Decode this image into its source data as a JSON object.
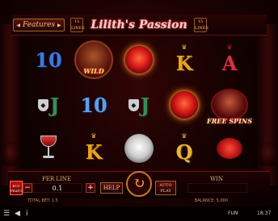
{
  "header": {
    "features_label": "Features",
    "title": "Lilith's Passion",
    "badge_left": "15 LINES",
    "badge_right": "15 LINES"
  },
  "reels": {
    "columns": [
      [
        "10",
        "J",
        "goblet"
      ],
      [
        "wild",
        "10",
        "K"
      ],
      [
        "heart",
        "J",
        "rose"
      ],
      [
        "K",
        "heart",
        "Q"
      ],
      [
        "A",
        "free-spins",
        "lips"
      ]
    ],
    "wild_label": "WILD",
    "free_spins_label": "FREE SPINS"
  },
  "controls": {
    "buy_label": "BUY FEATURE",
    "per_line_label": "PER LINE",
    "per_line_value": "0.1",
    "minus": "−",
    "plus": "+",
    "help_label": "HELP",
    "spin_icon": "↻",
    "autoplay_label": "AUTO PLAY",
    "win_label": "WIN",
    "win_value": ""
  },
  "info": {
    "total_bet": "TOTAL BET: 1.5",
    "balance": "BALANCE: 5,000"
  },
  "status": {
    "menu_icon": "☰",
    "sound_icon": "◀",
    "info_icon": "i",
    "mode": "FUN",
    "clock": "18:37"
  },
  "colors": {
    "background": "#1a0202",
    "accent_gold": "#e8a21c",
    "title_glow": "#ff2020"
  }
}
